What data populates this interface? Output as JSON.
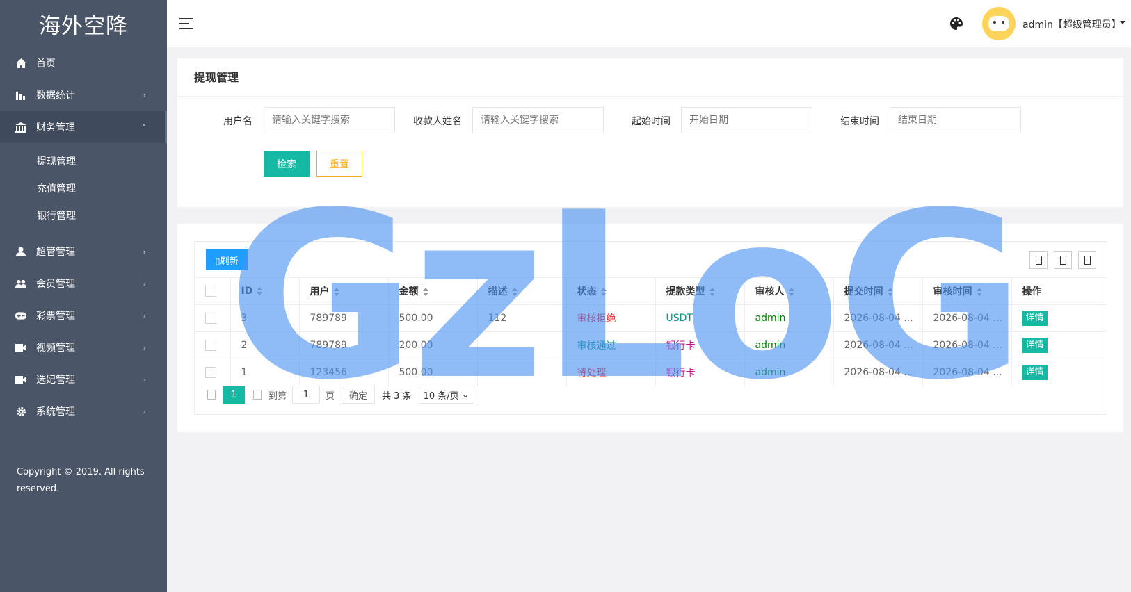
{
  "brand": {
    "title": "海外空降"
  },
  "sidebar": {
    "items": [
      {
        "label": "首页",
        "icon": "home-icon"
      },
      {
        "label": "数据统计",
        "icon": "bar-chart-icon"
      },
      {
        "label": "财务管理",
        "icon": "bank-icon"
      },
      {
        "label": "超管管理",
        "icon": "user-icon"
      },
      {
        "label": "会员管理",
        "icon": "users-icon"
      },
      {
        "label": "彩票管理",
        "icon": "gamepad-icon"
      },
      {
        "label": "视频管理",
        "icon": "video-icon"
      },
      {
        "label": "选妃管理",
        "icon": "video-icon"
      },
      {
        "label": "系统管理",
        "icon": "gear-icon"
      }
    ],
    "submenu": [
      "提现管理",
      "充值管理",
      "银行管理"
    ],
    "copyright": "Copyright © 2019. All rights reserved."
  },
  "header": {
    "user": "admin【超级管理员】"
  },
  "search": {
    "title": "提现管理",
    "fields": [
      {
        "label": "用户名",
        "placeholder": "请输入关键字搜索"
      },
      {
        "label": "收款人姓名",
        "placeholder": "请输入关键字搜索"
      },
      {
        "label": "起始时间",
        "placeholder": "开始日期"
      },
      {
        "label": "结束时间",
        "placeholder": "结束日期"
      }
    ],
    "search_label": "检索",
    "reset_label": "重置"
  },
  "table": {
    "refresh_label": "刷新",
    "columns": [
      "ID",
      "用户",
      "金额",
      "描述",
      "状态",
      "提款类型",
      "审核人",
      "提交时间",
      "审核时间",
      "操作"
    ],
    "rows": [
      {
        "id": "3",
        "user": "789789",
        "amount": "500.00",
        "desc": "112",
        "status": "审核拒绝",
        "type": "USDT",
        "reviewer": "admin",
        "submit": "2026-08-04 ...",
        "review": "2026-08-04 ...",
        "action": "详情"
      },
      {
        "id": "2",
        "user": "789789",
        "amount": "200.00",
        "desc": "",
        "status": "审核通过",
        "type": "银行卡",
        "reviewer": "admin",
        "submit": "2026-08-04 ...",
        "review": "2026-08-04 ...",
        "action": "详情"
      },
      {
        "id": "1",
        "user": "123456",
        "amount": "500.00",
        "desc": "",
        "status": "待处理",
        "type": "银行卡",
        "reviewer": "admin",
        "submit": "2026-08-04 ...",
        "review": "2026-08-04 ...",
        "action": "详情"
      }
    ],
    "colors": {
      "审核拒绝": "#ff2222",
      "审核通过": "#009688",
      "待处理": "#ff2222",
      "USDT": "#009688",
      "银行卡": "#c71585",
      "admin": "#008000"
    }
  },
  "pager": {
    "current": "1",
    "goto_label": "到第",
    "page_input": "1",
    "page_label": "页",
    "confirm_label": "确定",
    "total": "共 3 条",
    "page_size": "10 条/页"
  },
  "watermark": "GzLoG"
}
